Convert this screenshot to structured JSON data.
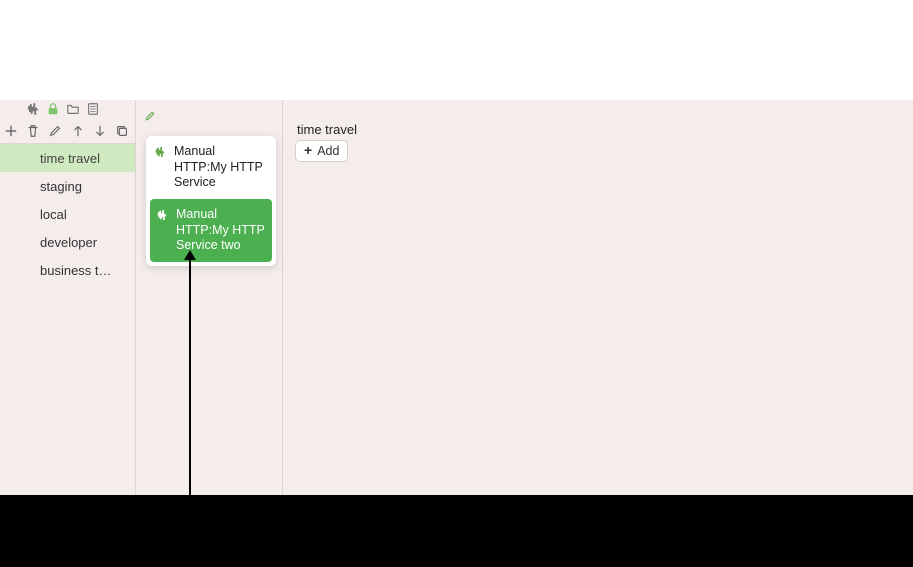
{
  "sidebar": {
    "items": [
      {
        "label": "time travel",
        "selected": true
      },
      {
        "label": "staging",
        "selected": false
      },
      {
        "label": "local",
        "selected": false
      },
      {
        "label": "developer",
        "selected": false
      },
      {
        "label": "business t…",
        "selected": false
      }
    ]
  },
  "services": {
    "items": [
      {
        "label": "Manual HTTP:My HTTP Service",
        "selected": false
      },
      {
        "label": "Manual HTTP:My HTTP Service two",
        "selected": true
      }
    ]
  },
  "main": {
    "title": "time travel",
    "add_label": "Add"
  }
}
